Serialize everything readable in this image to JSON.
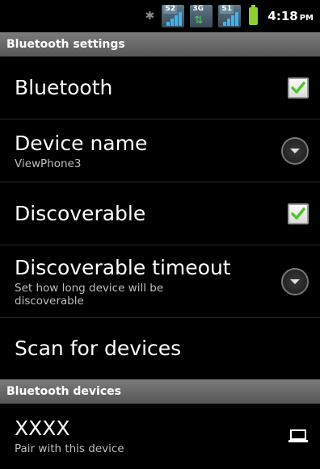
{
  "status_bar": {
    "sim1_label": "S2",
    "network_label": "3G",
    "sim2_label": "S1",
    "time": "4:18",
    "ampm": "PM"
  },
  "bluetooth_settings": {
    "header": "Bluetooth settings",
    "bluetooth": {
      "title": "Bluetooth",
      "checked": true
    },
    "device_name": {
      "title": "Device name",
      "value": "ViewPhone3"
    },
    "discoverable": {
      "title": "Discoverable",
      "checked": true
    },
    "discoverable_timeout": {
      "title": "Discoverable timeout",
      "summary": "Set how long device will be discoverable"
    },
    "scan": {
      "title": "Scan for devices"
    }
  },
  "bluetooth_devices": {
    "header": "Bluetooth devices",
    "items": [
      {
        "name": "XXXX",
        "summary": "Pair with this device",
        "icon": "laptop-icon"
      }
    ]
  },
  "colors": {
    "check_green": "#4fc52d",
    "battery": "#8ed12f",
    "signal": "#39b5f5"
  }
}
